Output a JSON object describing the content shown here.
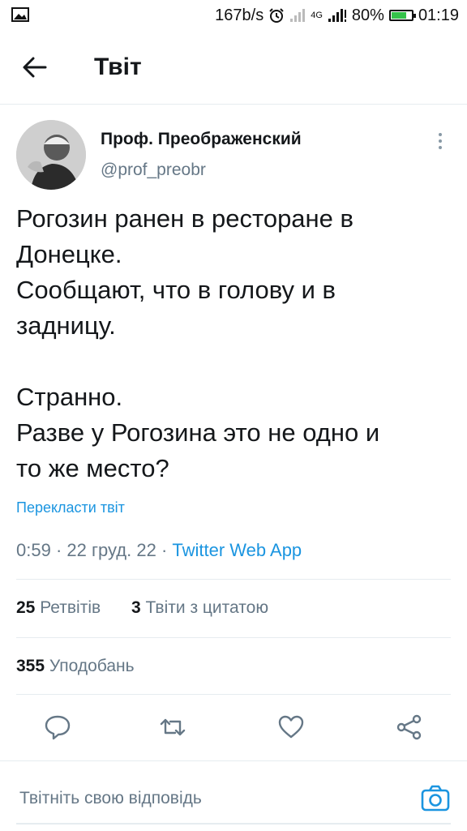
{
  "status_bar": {
    "speed": "167b/s",
    "network": "4G",
    "battery": "80%",
    "battery_level": 0.8,
    "time": "01:19"
  },
  "header": {
    "title": "Твіт"
  },
  "tweet": {
    "author_name": "Проф. Преображенский",
    "author_handle": "@prof_preobr",
    "text_lines": [
      "Рогозин ранен в ресторане в",
      "Донецке.",
      "Сообщают, что в голову и в",
      "задницу.",
      "",
      "Странно.",
      "Разве у Рогозина это не одно и",
      "то же место?"
    ],
    "translate_label": "Перекласти твіт",
    "time": "0:59",
    "date": "22 груд. 22",
    "source": "Twitter Web App",
    "retweets_count": "25",
    "retweets_label": "Ретвітів",
    "quotes_count": "3",
    "quotes_label": "Твіти з цитатою",
    "likes_count": "355",
    "likes_label": "Уподобань"
  },
  "reply": {
    "placeholder": "Твітніть свою відповідь"
  },
  "colors": {
    "accent": "#1b95e0",
    "secondary_text": "#657786",
    "divider": "#e6ecf0",
    "battery": "#35c24a"
  }
}
